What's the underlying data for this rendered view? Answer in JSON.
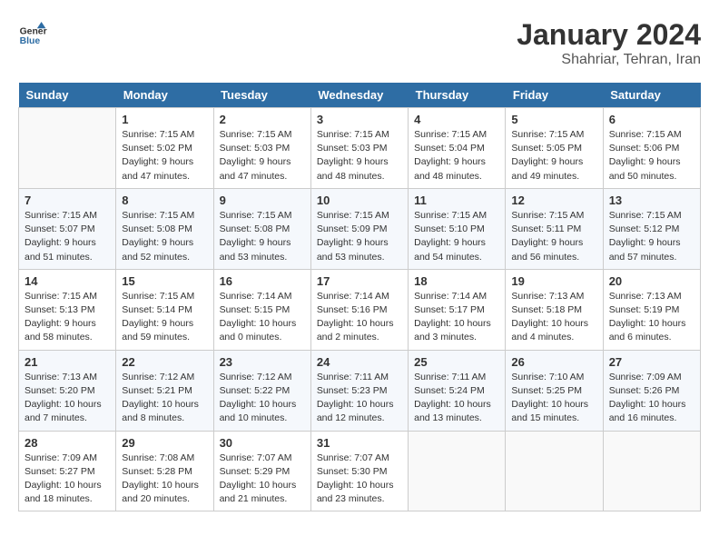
{
  "header": {
    "logo_line1": "General",
    "logo_line2": "Blue",
    "month_year": "January 2024",
    "location": "Shahriar, Tehran, Iran"
  },
  "weekdays": [
    "Sunday",
    "Monday",
    "Tuesday",
    "Wednesday",
    "Thursday",
    "Friday",
    "Saturday"
  ],
  "weeks": [
    [
      {
        "day": "",
        "info": ""
      },
      {
        "day": "1",
        "info": "Sunrise: 7:15 AM\nSunset: 5:02 PM\nDaylight: 9 hours\nand 47 minutes."
      },
      {
        "day": "2",
        "info": "Sunrise: 7:15 AM\nSunset: 5:03 PM\nDaylight: 9 hours\nand 47 minutes."
      },
      {
        "day": "3",
        "info": "Sunrise: 7:15 AM\nSunset: 5:03 PM\nDaylight: 9 hours\nand 48 minutes."
      },
      {
        "day": "4",
        "info": "Sunrise: 7:15 AM\nSunset: 5:04 PM\nDaylight: 9 hours\nand 48 minutes."
      },
      {
        "day": "5",
        "info": "Sunrise: 7:15 AM\nSunset: 5:05 PM\nDaylight: 9 hours\nand 49 minutes."
      },
      {
        "day": "6",
        "info": "Sunrise: 7:15 AM\nSunset: 5:06 PM\nDaylight: 9 hours\nand 50 minutes."
      }
    ],
    [
      {
        "day": "7",
        "info": "Sunrise: 7:15 AM\nSunset: 5:07 PM\nDaylight: 9 hours\nand 51 minutes."
      },
      {
        "day": "8",
        "info": "Sunrise: 7:15 AM\nSunset: 5:08 PM\nDaylight: 9 hours\nand 52 minutes."
      },
      {
        "day": "9",
        "info": "Sunrise: 7:15 AM\nSunset: 5:08 PM\nDaylight: 9 hours\nand 53 minutes."
      },
      {
        "day": "10",
        "info": "Sunrise: 7:15 AM\nSunset: 5:09 PM\nDaylight: 9 hours\nand 53 minutes."
      },
      {
        "day": "11",
        "info": "Sunrise: 7:15 AM\nSunset: 5:10 PM\nDaylight: 9 hours\nand 54 minutes."
      },
      {
        "day": "12",
        "info": "Sunrise: 7:15 AM\nSunset: 5:11 PM\nDaylight: 9 hours\nand 56 minutes."
      },
      {
        "day": "13",
        "info": "Sunrise: 7:15 AM\nSunset: 5:12 PM\nDaylight: 9 hours\nand 57 minutes."
      }
    ],
    [
      {
        "day": "14",
        "info": "Sunrise: 7:15 AM\nSunset: 5:13 PM\nDaylight: 9 hours\nand 58 minutes."
      },
      {
        "day": "15",
        "info": "Sunrise: 7:15 AM\nSunset: 5:14 PM\nDaylight: 9 hours\nand 59 minutes."
      },
      {
        "day": "16",
        "info": "Sunrise: 7:14 AM\nSunset: 5:15 PM\nDaylight: 10 hours\nand 0 minutes."
      },
      {
        "day": "17",
        "info": "Sunrise: 7:14 AM\nSunset: 5:16 PM\nDaylight: 10 hours\nand 2 minutes."
      },
      {
        "day": "18",
        "info": "Sunrise: 7:14 AM\nSunset: 5:17 PM\nDaylight: 10 hours\nand 3 minutes."
      },
      {
        "day": "19",
        "info": "Sunrise: 7:13 AM\nSunset: 5:18 PM\nDaylight: 10 hours\nand 4 minutes."
      },
      {
        "day": "20",
        "info": "Sunrise: 7:13 AM\nSunset: 5:19 PM\nDaylight: 10 hours\nand 6 minutes."
      }
    ],
    [
      {
        "day": "21",
        "info": "Sunrise: 7:13 AM\nSunset: 5:20 PM\nDaylight: 10 hours\nand 7 minutes."
      },
      {
        "day": "22",
        "info": "Sunrise: 7:12 AM\nSunset: 5:21 PM\nDaylight: 10 hours\nand 8 minutes."
      },
      {
        "day": "23",
        "info": "Sunrise: 7:12 AM\nSunset: 5:22 PM\nDaylight: 10 hours\nand 10 minutes."
      },
      {
        "day": "24",
        "info": "Sunrise: 7:11 AM\nSunset: 5:23 PM\nDaylight: 10 hours\nand 12 minutes."
      },
      {
        "day": "25",
        "info": "Sunrise: 7:11 AM\nSunset: 5:24 PM\nDaylight: 10 hours\nand 13 minutes."
      },
      {
        "day": "26",
        "info": "Sunrise: 7:10 AM\nSunset: 5:25 PM\nDaylight: 10 hours\nand 15 minutes."
      },
      {
        "day": "27",
        "info": "Sunrise: 7:09 AM\nSunset: 5:26 PM\nDaylight: 10 hours\nand 16 minutes."
      }
    ],
    [
      {
        "day": "28",
        "info": "Sunrise: 7:09 AM\nSunset: 5:27 PM\nDaylight: 10 hours\nand 18 minutes."
      },
      {
        "day": "29",
        "info": "Sunrise: 7:08 AM\nSunset: 5:28 PM\nDaylight: 10 hours\nand 20 minutes."
      },
      {
        "day": "30",
        "info": "Sunrise: 7:07 AM\nSunset: 5:29 PM\nDaylight: 10 hours\nand 21 minutes."
      },
      {
        "day": "31",
        "info": "Sunrise: 7:07 AM\nSunset: 5:30 PM\nDaylight: 10 hours\nand 23 minutes."
      },
      {
        "day": "",
        "info": ""
      },
      {
        "day": "",
        "info": ""
      },
      {
        "day": "",
        "info": ""
      }
    ]
  ]
}
